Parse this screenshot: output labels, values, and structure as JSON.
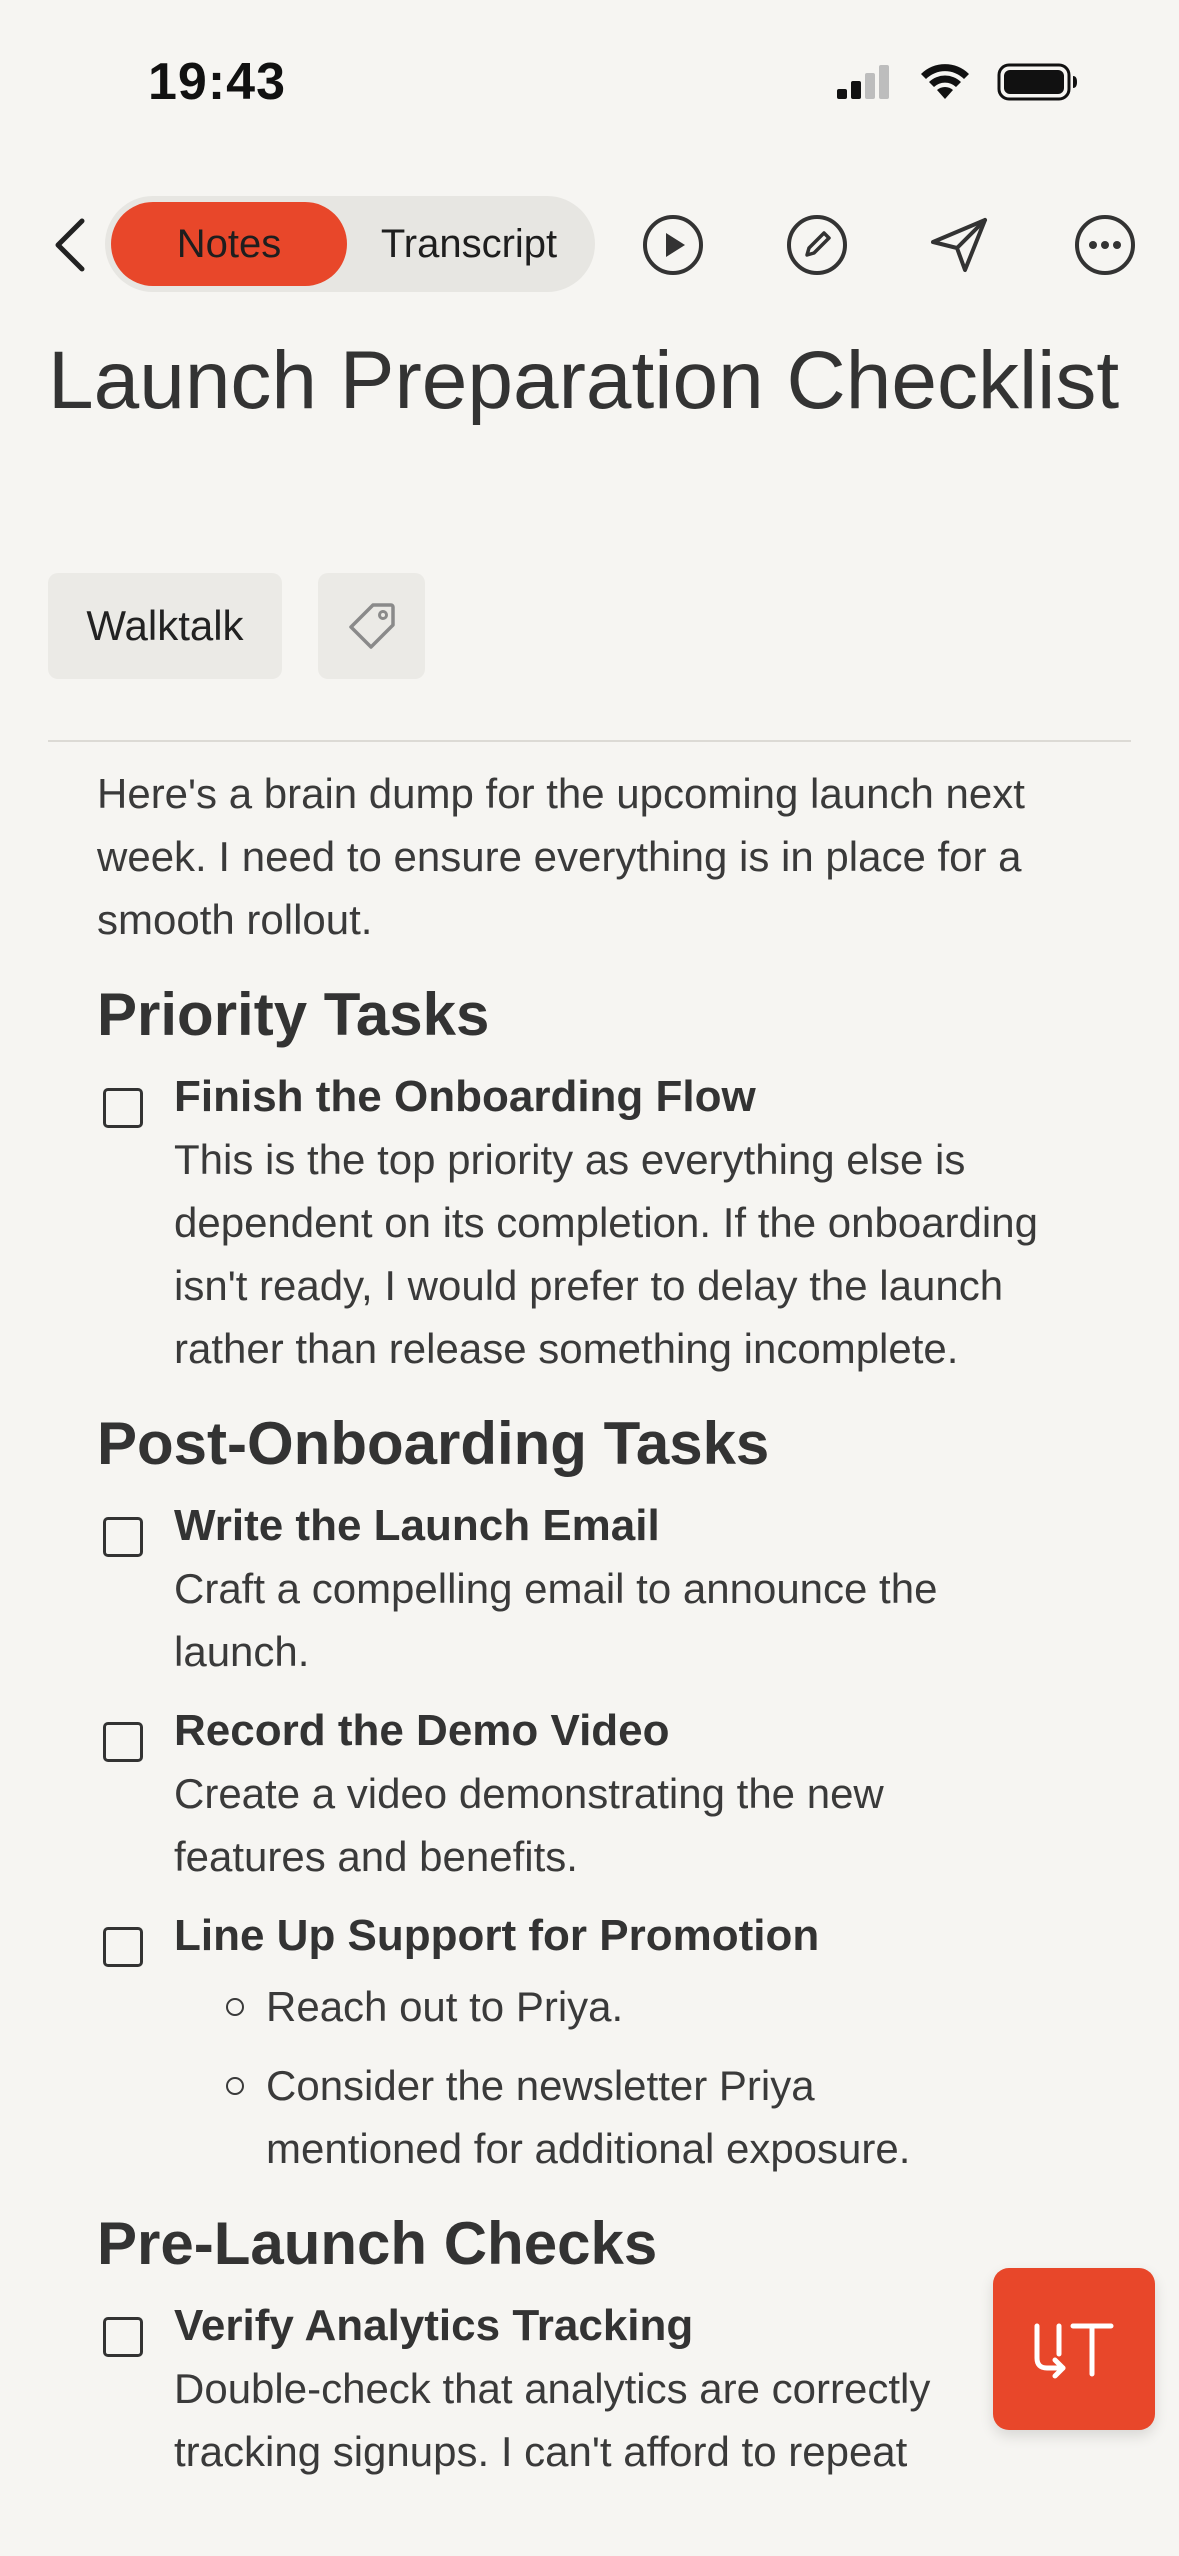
{
  "status_bar": {
    "time": "19:43"
  },
  "toolbar": {
    "tabs": [
      {
        "label": "Notes",
        "active": true
      },
      {
        "label": "Transcript",
        "active": false
      }
    ],
    "icons": [
      "back-chevron-icon",
      "play-icon",
      "edit-icon",
      "share-icon",
      "more-icon"
    ]
  },
  "note": {
    "title": "Launch Preparation Checklist",
    "tag": "Walktalk",
    "intro": "Here's a brain dump for the upcoming launch next week. I need to ensure everything is in place for a smooth rollout.",
    "sections": [
      {
        "heading": "Priority Tasks",
        "tasks": [
          {
            "title": "Finish the Onboarding Flow",
            "desc": "This is the top priority as everything else is dependent on its completion. If the onboarding isn't ready, I would prefer to delay the launch rather than release something incomplete."
          }
        ]
      },
      {
        "heading": "Post-Onboarding Tasks",
        "tasks": [
          {
            "title": "Write the Launch Email",
            "desc": "Craft a compelling email to announce the launch."
          },
          {
            "title": "Record the Demo Video",
            "desc": "Create a video demonstrating the new features and benefits."
          },
          {
            "title": "Line Up Support for Promotion",
            "subitems": [
              "Reach out to Priya.",
              "Consider the newsletter Priya mentioned for additional exposure."
            ]
          }
        ]
      },
      {
        "heading": "Pre-Launch Checks",
        "tasks": [
          {
            "title": "Verify Analytics Tracking",
            "desc": "Double-check that analytics are correctly tracking signups. I can't afford to repeat"
          }
        ]
      }
    ]
  },
  "colors": {
    "accent": "#E8472A",
    "background": "#F6F5F2",
    "text": "#333333"
  }
}
